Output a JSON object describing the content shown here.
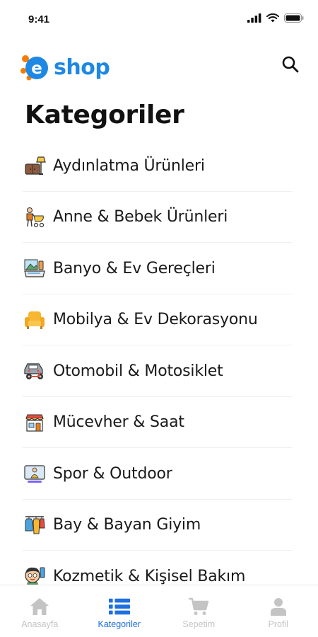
{
  "status_bar": {
    "time": "9:41"
  },
  "header": {
    "logo_letter": "e",
    "logo_text": "shop"
  },
  "page": {
    "title": "Kategoriler"
  },
  "categories": [
    {
      "label": "Aydınlatma Ürünleri",
      "icon": "lamp-icon"
    },
    {
      "label": "Anne & Bebek Ürünleri",
      "icon": "stroller-icon"
    },
    {
      "label": "Banyo & Ev Gereçleri",
      "icon": "bathroom-icon"
    },
    {
      "label": "Mobilya & Ev Dekorasyonu",
      "icon": "armchair-icon"
    },
    {
      "label": "Otomobil & Motosiklet",
      "icon": "car-icon"
    },
    {
      "label": "Mücevher & Saat",
      "icon": "jewelry-store-icon"
    },
    {
      "label": "Spor & Outdoor",
      "icon": "fitness-icon"
    },
    {
      "label": "Bay & Bayan Giyim",
      "icon": "clothing-icon"
    },
    {
      "label": "Kozmetik & Kişisel Bakım",
      "icon": "cosmetics-icon"
    }
  ],
  "bottom_nav": [
    {
      "label": "Anasayfa",
      "icon": "home-icon",
      "active": false
    },
    {
      "label": "Kategoriler",
      "icon": "list-icon",
      "active": true
    },
    {
      "label": "Sepetim",
      "icon": "cart-icon",
      "active": false
    },
    {
      "label": "Profil",
      "icon": "user-icon",
      "active": false
    }
  ],
  "colors": {
    "brand": "#1e88e5",
    "active_nav": "#1e6fe0",
    "inactive_nav": "#c4c4c4"
  }
}
